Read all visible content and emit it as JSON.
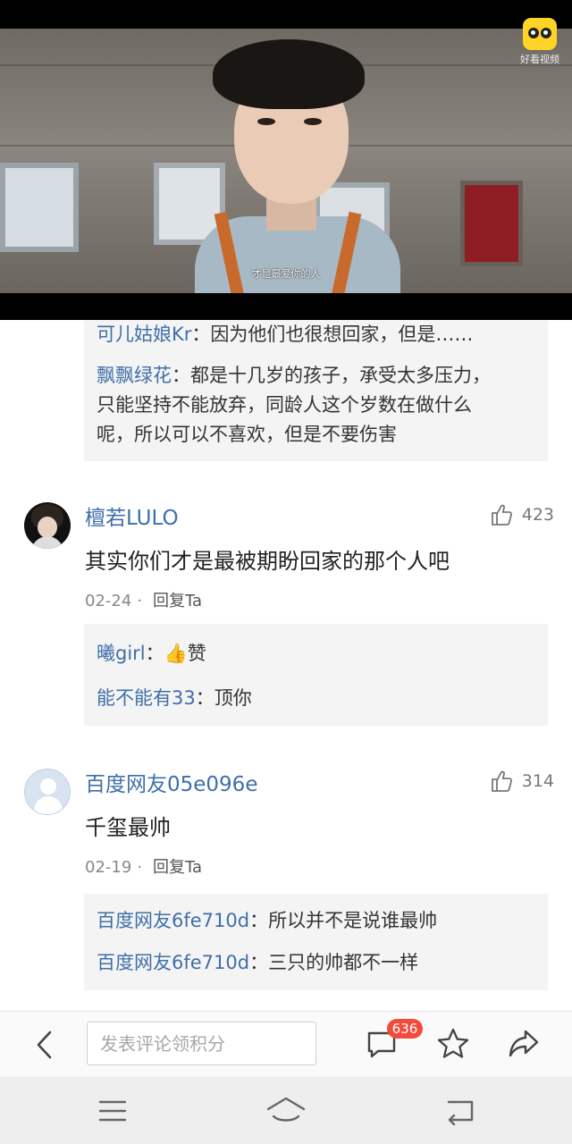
{
  "video": {
    "subtitle": "才是最爱你的人",
    "logo_text": "好看视频"
  },
  "first_replies": [
    {
      "user": "可儿姑娘Kr",
      "sep": "：",
      "text": "因为他们也很想回家，但是……"
    },
    {
      "user": "飘飘绿花",
      "sep": "：",
      "text_lines": [
        "都是十几岁的孩子，承受太多压力，",
        "只能坚持不能放弃，同龄人这个岁数在做什么",
        "呢，所以可以不喜欢，但是不要伤害"
      ]
    }
  ],
  "comments": [
    {
      "username": "檀若LULO",
      "likes": "423",
      "text": "其实你们才是最被期盼回家的那个人吧",
      "date": "02-24",
      "separator": "·",
      "reply_label": "回复Ta",
      "replies": [
        {
          "user": "曦girl",
          "sep": "：",
          "emoji": "👍",
          "text": "赞"
        },
        {
          "user": "能不能有33",
          "sep": "：",
          "text": "顶你"
        }
      ]
    },
    {
      "username": "百度网友05e096e",
      "likes": "314",
      "text": "千玺最帅",
      "date": "02-19",
      "separator": "·",
      "reply_label": "回复Ta",
      "replies": [
        {
          "user": "百度网友6fe710d",
          "sep": "：",
          "text": "所以并不是说谁最帅"
        },
        {
          "user": "百度网友6fe710d",
          "sep": "：",
          "text": "三只的帅都不一样"
        }
      ]
    }
  ],
  "action_bar": {
    "input_placeholder": "发表评论领积分",
    "comment_count": "636"
  },
  "icons": {
    "back": "chevron-left-icon",
    "comment": "comment-bubble-icon",
    "favorite": "star-icon",
    "share": "share-arrow-icon",
    "like": "thumbs-up-icon",
    "menu": "menu-icon",
    "home": "home-icon",
    "return": "return-icon"
  },
  "colors": {
    "username": "#3f6fa8",
    "badge": "#f24a3c",
    "reply_bg": "#f4f4f4"
  }
}
